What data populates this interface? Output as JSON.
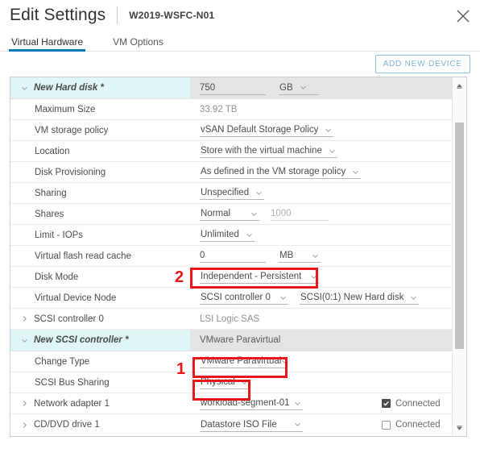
{
  "header": {
    "title": "Edit Settings",
    "subtitle": "W2019-WSFC-N01",
    "close_icon": "close-icon"
  },
  "tabs": [
    {
      "label": "Virtual Hardware",
      "active": true
    },
    {
      "label": "VM Options",
      "active": false
    }
  ],
  "toolbar": {
    "add_device_label": "ADD NEW DEVICE"
  },
  "table": {
    "rows": [
      {
        "type": "group",
        "label": "New Hard disk *",
        "caret": "chevron-down-icon",
        "value_text": "",
        "value_input": "750",
        "unit_select": "GB"
      },
      {
        "type": "readonly",
        "label": "Maximum Size",
        "value": "33.92 TB"
      },
      {
        "type": "select",
        "label": "VM storage policy",
        "value": "vSAN Default Storage Policy"
      },
      {
        "type": "select",
        "label": "Location",
        "value": "Store with the virtual machine"
      },
      {
        "type": "select",
        "label": "Disk Provisioning",
        "value": "As defined in the VM storage policy"
      },
      {
        "type": "select",
        "label": "Sharing",
        "value": "Unspecified"
      },
      {
        "type": "select-plus-input",
        "label": "Shares",
        "value": "Normal",
        "input": "1000"
      },
      {
        "type": "select",
        "label": "Limit - IOPs",
        "value": "Unlimited"
      },
      {
        "type": "input-plus-select",
        "label": "Virtual flash read cache",
        "input": "0",
        "value": "MB"
      },
      {
        "type": "select",
        "label": "Disk Mode",
        "value": "Independent - Persistent"
      },
      {
        "type": "dual-select",
        "label": "Virtual Device Node",
        "value": "SCSI controller 0",
        "value2": "SCSI(0:1) New Hard disk"
      },
      {
        "type": "collapsed",
        "label": "SCSI controller 0",
        "caret": "chevron-right-icon",
        "value": "LSI Logic SAS"
      },
      {
        "type": "group",
        "label": "New SCSI controller *",
        "caret": "chevron-down-icon",
        "value_text": "VMware Paravirtual"
      },
      {
        "type": "select",
        "label": "Change Type",
        "value": "VMware Paravirtual"
      },
      {
        "type": "select",
        "label": "SCSI Bus Sharing",
        "value": "Physical"
      },
      {
        "type": "select-check",
        "label": "Network adapter 1",
        "caret": "chevron-right-icon",
        "value": "workload-segment-01",
        "checkbox_label": "Connected",
        "checked": true
      },
      {
        "type": "select-check",
        "label": "CD/DVD drive 1",
        "caret": "chevron-right-icon",
        "value": "Datastore ISO File",
        "checkbox_label": "Connected",
        "checked": false
      }
    ]
  },
  "annotations": [
    {
      "number": "1",
      "target": "change-type-select"
    },
    {
      "number": "2",
      "target": "disk-mode-select"
    }
  ],
  "colors": {
    "accent": "#0079b8",
    "group_label_bg": "#e0f5f5",
    "group_value_bg": "#e2e4e5",
    "annotation_red": "#e8161b",
    "button_border": "#8bc0de"
  }
}
